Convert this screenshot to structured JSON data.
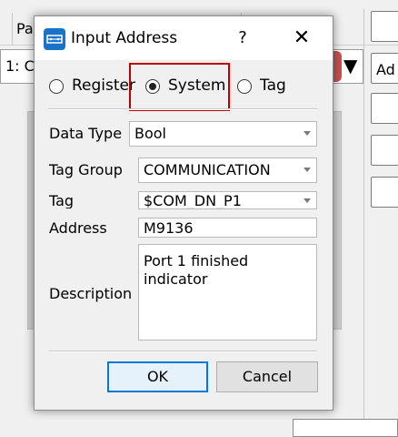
{
  "background": {
    "header_label": "Pa",
    "select_text": "1: C",
    "button_label": "Ad"
  },
  "dialog": {
    "title": "Input Address",
    "help_label": "?",
    "close_label": "✕",
    "modes": [
      {
        "label": "Register",
        "checked": false
      },
      {
        "label": "System",
        "checked": true
      },
      {
        "label": "Tag",
        "checked": false
      }
    ],
    "fields": {
      "data_type_label": "Data Type",
      "data_type_value": "Bool",
      "tag_group_label": "Tag Group",
      "tag_group_value": "COMMUNICATION",
      "tag_label": "Tag",
      "tag_value": "$COM_DN_P1",
      "address_label": "Address",
      "address_value": "M9136",
      "description_label": "Description",
      "description_value": "Port 1 finished indicator"
    },
    "buttons": {
      "ok": "OK",
      "cancel": "Cancel"
    }
  },
  "colors": {
    "highlight": "#c00000",
    "accent": "#0078d7",
    "icon": "#1a73c9"
  }
}
